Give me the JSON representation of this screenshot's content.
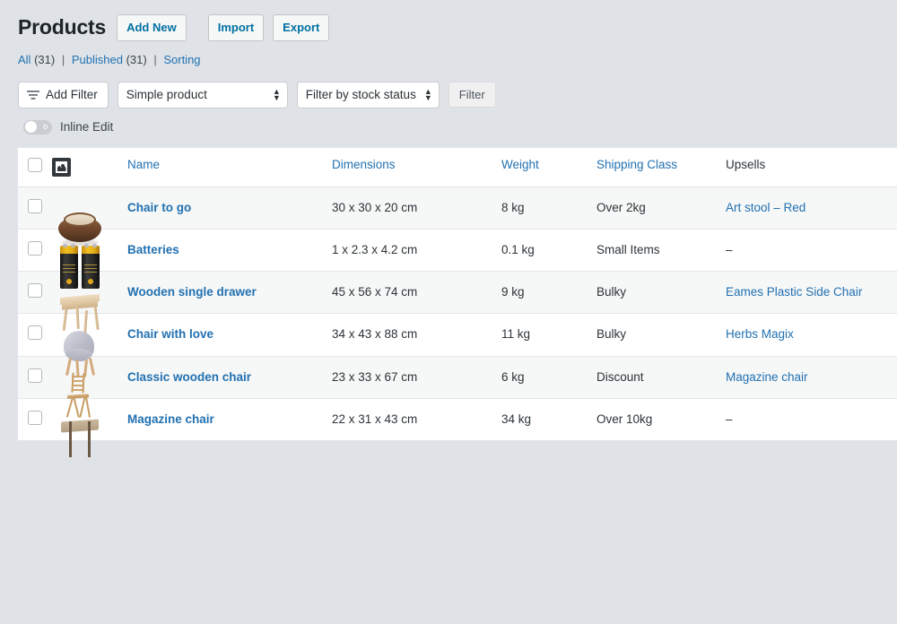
{
  "header": {
    "title": "Products",
    "buttons": [
      {
        "label": "Add New",
        "name": "add-new-button"
      },
      {
        "label": "Import",
        "name": "import-button"
      },
      {
        "label": "Export",
        "name": "export-button"
      }
    ]
  },
  "views": {
    "all_label": "All",
    "all_count": "(31)",
    "published_label": "Published",
    "published_count": "(31)",
    "sorting_label": "Sorting",
    "separator": "|"
  },
  "toolbar": {
    "add_filter_label": "Add Filter",
    "product_type_selected": "Simple product",
    "product_type_options": [
      "Simple product"
    ],
    "stock_status_selected": "Filter by stock status",
    "stock_status_options": [
      "Filter by stock status"
    ],
    "filter_button_label": "Filter",
    "inline_edit_label": "Inline Edit",
    "inline_edit_state": "off"
  },
  "table": {
    "columns": [
      {
        "key": "cb",
        "label": "",
        "sortable": false
      },
      {
        "key": "thumb",
        "label": "",
        "sortable": false
      },
      {
        "key": "name",
        "label": "Name",
        "sortable": true
      },
      {
        "key": "dimensions",
        "label": "Dimensions",
        "sortable": true
      },
      {
        "key": "weight",
        "label": "Weight",
        "sortable": true
      },
      {
        "key": "shipping_class",
        "label": "Shipping Class",
        "sortable": true
      },
      {
        "key": "upsells",
        "label": "Upsells",
        "sortable": false
      }
    ],
    "rows": [
      {
        "name": "Chair to go",
        "dimensions": "30 x 30 x 20 cm",
        "weight": "8 kg",
        "shipping_class": "Over 2kg",
        "upsells": "Art stool – Red",
        "upsells_is_link": true,
        "thumb": "wooden-bowl-stool-thumbnail"
      },
      {
        "name": "Batteries",
        "dimensions": "1 x 2.3 x 4.2 cm",
        "weight": "0.1 kg",
        "shipping_class": "Small Items",
        "upsells": "–",
        "upsells_is_link": false,
        "thumb": "batteries-thumbnail"
      },
      {
        "name": "Wooden single drawer",
        "dimensions": "45 x 56 x 74 cm",
        "weight": "9 kg",
        "shipping_class": "Bulky",
        "upsells": "Eames Plastic Side Chair",
        "upsells_is_link": true,
        "thumb": "wooden-table-thumbnail"
      },
      {
        "name": "Chair with love",
        "dimensions": "34 x 43 x 88 cm",
        "weight": "11 kg",
        "shipping_class": "Bulky",
        "upsells": "Herbs Magix",
        "upsells_is_link": true,
        "thumb": "grey-chair-thumbnail"
      },
      {
        "name": "Classic wooden chair",
        "dimensions": "23 x 33 x 67 cm",
        "weight": "6 kg",
        "shipping_class": "Discount",
        "upsells": "Magazine chair",
        "upsells_is_link": true,
        "thumb": "folding-chair-thumbnail"
      },
      {
        "name": "Magazine chair",
        "dimensions": "22 x 31 x 43 cm",
        "weight": "34 kg",
        "shipping_class": "Over 10kg",
        "upsells": "–",
        "upsells_is_link": false,
        "thumb": "magazine-stack-thumbnail"
      }
    ]
  },
  "colors": {
    "link": "#2271b1",
    "text": "#2c3338",
    "page_background": "#dfe3e8",
    "row_alt": "#f6f7f7"
  }
}
